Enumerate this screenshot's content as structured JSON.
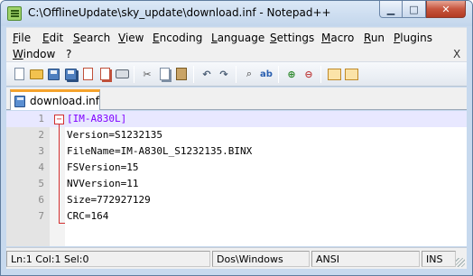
{
  "window": {
    "title": "C:\\OfflineUpdate\\sky_update\\download.inf - Notepad++",
    "minimize_icon": "minimize-icon",
    "maximize_icon": "maximize-icon",
    "close_icon": "close-icon"
  },
  "menu": {
    "items": [
      "File",
      "Edit",
      "Search",
      "View",
      "Encoding",
      "Language",
      "Settings",
      "Macro",
      "Run",
      "Plugins",
      "Window",
      "?"
    ],
    "close_doc": "X"
  },
  "toolbar": {
    "icons": [
      "new-file-icon",
      "open-file-icon",
      "save-icon",
      "save-all-icon",
      "close-icon",
      "close-all-icon",
      "print-icon",
      "cut-icon",
      "copy-icon",
      "paste-icon",
      "undo-icon",
      "redo-icon",
      "find-icon",
      "replace-icon",
      "zoom-in-icon",
      "zoom-out-icon",
      "sync-vertical-icon",
      "sync-horizontal-icon"
    ]
  },
  "tabs": [
    {
      "label": "download.inf",
      "icon": "save-icon",
      "active": true
    }
  ],
  "editor": {
    "current_line": 1,
    "lines": [
      {
        "num": "1",
        "text": "[IM-A830L]"
      },
      {
        "num": "2",
        "text": "Version=S1232135"
      },
      {
        "num": "3",
        "text": "FileName=IM-A830L_S1232135.BINX"
      },
      {
        "num": "4",
        "text": "FSVersion=15"
      },
      {
        "num": "5",
        "text": "NVVersion=11"
      },
      {
        "num": "6",
        "text": "Size=772927129"
      },
      {
        "num": "7",
        "text": "CRC=164"
      }
    ],
    "fold_marker": "−",
    "colors": {
      "section": "#8000ff",
      "fold": "#d32f2f",
      "current_line": "#e8e8ff"
    }
  },
  "statusbar": {
    "position": "Ln:1   Col:1   Sel:0",
    "eol": "Dos\\Windows",
    "encoding": "ANSI",
    "mode": "INS"
  }
}
